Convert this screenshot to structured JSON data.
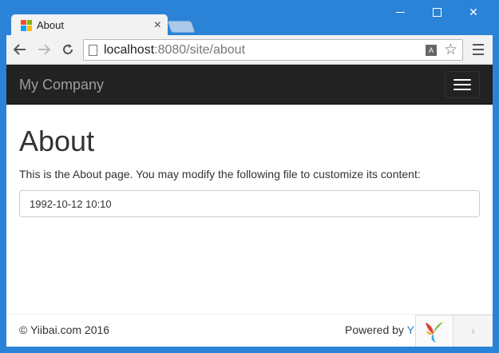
{
  "browser": {
    "tab_title": "About",
    "tab_close": "×",
    "url_host": "localhost",
    "url_rest": ":8080/site/about",
    "window_close": "✕"
  },
  "navbar": {
    "brand": "My Company"
  },
  "page": {
    "heading": "About",
    "description": "This is the About page. You may modify the following file to customize its content:",
    "code_value": "1992-10-12 10:10"
  },
  "footer": {
    "copyright": "© Yiibai.com 2016",
    "powered_by": "Powered by ",
    "powered_link": "Y"
  },
  "debug_toolbar": {
    "arrow": "›"
  },
  "colors": {
    "navbar_bg": "#222222",
    "link": "#337ab7",
    "window_frame": "#2b83d8"
  }
}
